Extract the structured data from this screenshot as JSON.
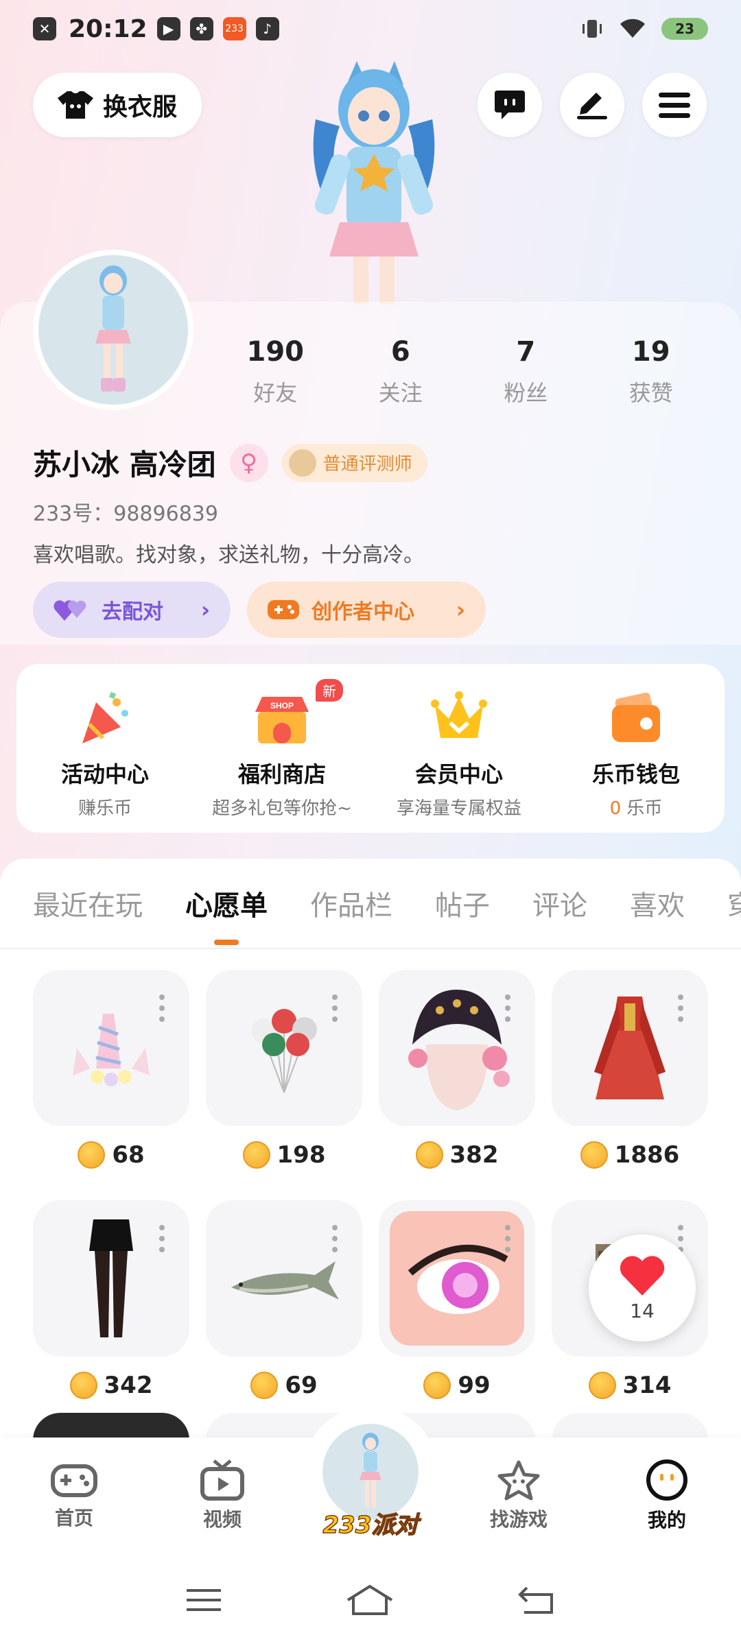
{
  "status_bar": {
    "time": "20:12",
    "battery": "23",
    "left_icons": [
      "close-icon",
      "play-icon",
      "grid-icon",
      "app-233-icon",
      "music-icon"
    ],
    "right_icons": [
      "vibrate-icon",
      "wifi-icon",
      "battery-icon"
    ]
  },
  "header": {
    "dress_label": "换衣服"
  },
  "profile": {
    "stats": [
      {
        "num": "190",
        "label": "好友"
      },
      {
        "num": "6",
        "label": "关注"
      },
      {
        "num": "7",
        "label": "粉丝"
      },
      {
        "num": "19",
        "label": "获赞"
      }
    ],
    "name": "苏小冰   高冷团",
    "gender_symbol": "♀",
    "badge": "普通评测师",
    "uid": "233号：98896839",
    "bio": "喜欢唱歌。找对象，求送礼物，十分高冷。",
    "match_label": "去配对",
    "creator_label": "创作者中心"
  },
  "features": [
    {
      "title": "活动中心",
      "sub": "赚乐币"
    },
    {
      "title": "福利商店",
      "sub": "超多礼包等你抢~",
      "tag": "新"
    },
    {
      "title": "会员中心",
      "sub": "享海量专属权益"
    },
    {
      "title": "乐币钱包",
      "sub_num": "0",
      "sub_unit": " 乐币"
    }
  ],
  "tabs": [
    "最近在玩",
    "心愿单",
    "作品栏",
    "帖子",
    "评论",
    "喜欢",
    "穿"
  ],
  "active_tab": "心愿单",
  "wishlist": [
    {
      "price": "68",
      "item": "unicorn-headband"
    },
    {
      "price": "198",
      "item": "balloons"
    },
    {
      "price": "382",
      "item": "flower-headdress"
    },
    {
      "price": "1886",
      "item": "red-dress"
    },
    {
      "price": "342",
      "item": "skirt-tights"
    },
    {
      "price": "69",
      "item": "fish"
    },
    {
      "price": "99",
      "item": "pink-eye"
    },
    {
      "price": "314",
      "item": "box"
    }
  ],
  "like_fab": {
    "count": "14"
  },
  "bottom_nav": [
    {
      "label": "首页",
      "icon": "gamepad-icon"
    },
    {
      "label": "视频",
      "icon": "tv-icon"
    },
    {
      "label": "233派对",
      "icon": "party-avatar"
    },
    {
      "label": "找游戏",
      "icon": "star-icon"
    },
    {
      "label": "我的",
      "icon": "me-icon"
    }
  ],
  "colors": {
    "accent": "#f07a22",
    "purple": "#7a55d8",
    "pink": "#f06d9b"
  }
}
